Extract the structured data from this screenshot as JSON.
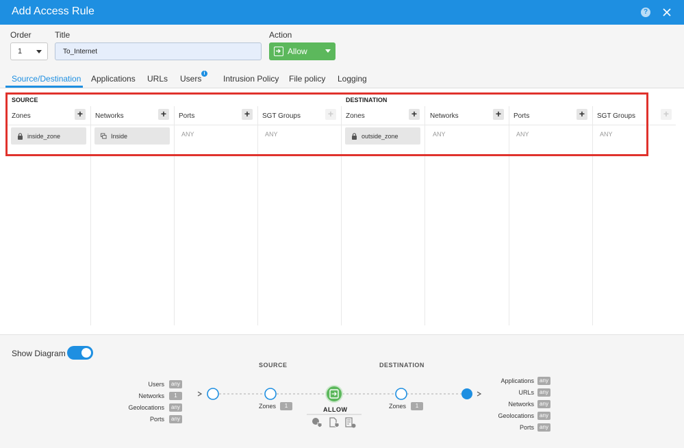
{
  "window": {
    "title": "Add Access Rule"
  },
  "form": {
    "order_label": "Order",
    "order_value": "1",
    "title_label": "Title",
    "title_value": "To_Internet",
    "action_label": "Action",
    "action_value": "Allow",
    "accent_color": "#1e8fe1",
    "allow_color": "#5cb85c"
  },
  "tabs": [
    {
      "label": "Source/Destination",
      "active": true
    },
    {
      "label": "Applications"
    },
    {
      "label": "URLs"
    },
    {
      "label": "Users"
    },
    {
      "label": "Intrusion Policy"
    },
    {
      "label": "File policy"
    },
    {
      "label": "Logging"
    }
  ],
  "source": {
    "title": "SOURCE",
    "columns": [
      {
        "header": "Zones",
        "chip": "inside_zone",
        "icon": "lock-icon"
      },
      {
        "header": "Networks",
        "chip": "Inside",
        "icon": "network-object-icon"
      },
      {
        "header": "Ports",
        "value": "ANY"
      },
      {
        "header": "SGT Groups",
        "value": "ANY"
      }
    ]
  },
  "destination": {
    "title": "DESTINATION",
    "columns": [
      {
        "header": "Zones",
        "chip": "outside_zone",
        "icon": "lock-icon"
      },
      {
        "header": "Networks",
        "value": "ANY"
      },
      {
        "header": "Ports",
        "value": "ANY"
      },
      {
        "header": "SGT Groups",
        "value": "ANY"
      }
    ]
  },
  "diagram": {
    "toggle_label": "Show Diagram",
    "toggle_on": true,
    "source_title": "SOURCE",
    "destination_title": "DESTINATION",
    "left_list": [
      {
        "label": "Users",
        "badge": "any"
      },
      {
        "label": "Networks",
        "badge": "1"
      },
      {
        "label": "Geolocations",
        "badge": "any"
      },
      {
        "label": "Ports",
        "badge": "any"
      }
    ],
    "source_zones_label": "Zones",
    "source_zones_badge": "1",
    "action_label": "ALLOW",
    "dest_zones_label": "Zones",
    "dest_zones_badge": "1",
    "right_list": [
      {
        "label": "Applications",
        "badge": "any"
      },
      {
        "label": "URLs",
        "badge": "any"
      },
      {
        "label": "Networks",
        "badge": "any"
      },
      {
        "label": "Geolocations",
        "badge": "any"
      },
      {
        "label": "Ports",
        "badge": "any"
      }
    ],
    "policy_icons": [
      "intrusion-policy-icon",
      "file-policy-icon",
      "logging-icon"
    ]
  }
}
